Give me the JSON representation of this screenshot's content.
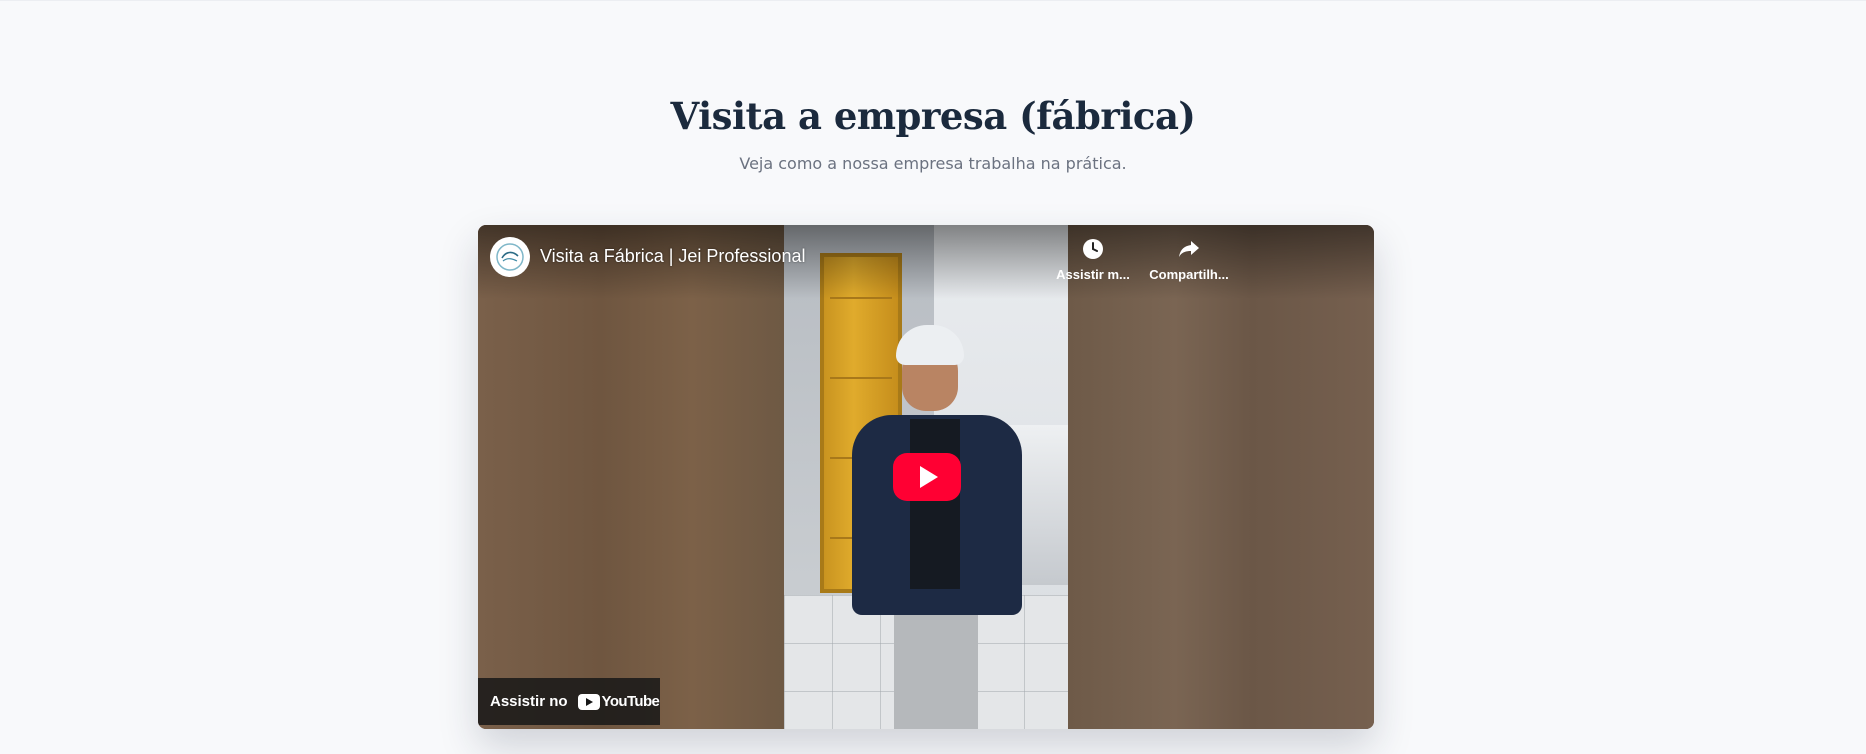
{
  "section": {
    "title": "Visita a empresa (fábrica)",
    "subtitle": "Veja como a nossa empresa trabalha na prática."
  },
  "video": {
    "title": "Visita a Fábrica | Jei Professional",
    "channel_avatar_icon": "jei-professional-logo",
    "actions": [
      {
        "label": "Assistir m...",
        "icon": "clock-icon"
      },
      {
        "label": "Compartilh...",
        "icon": "share-arrow-icon"
      }
    ],
    "play_button_icon": "youtube-play-icon",
    "watch_on": {
      "label": "Assistir no",
      "brand": "YouTube"
    }
  },
  "colors": {
    "page_background": "#f8f9fb",
    "title": "#1b2a3d",
    "subtitle": "#6b7280",
    "play_red": "#ff0033"
  }
}
